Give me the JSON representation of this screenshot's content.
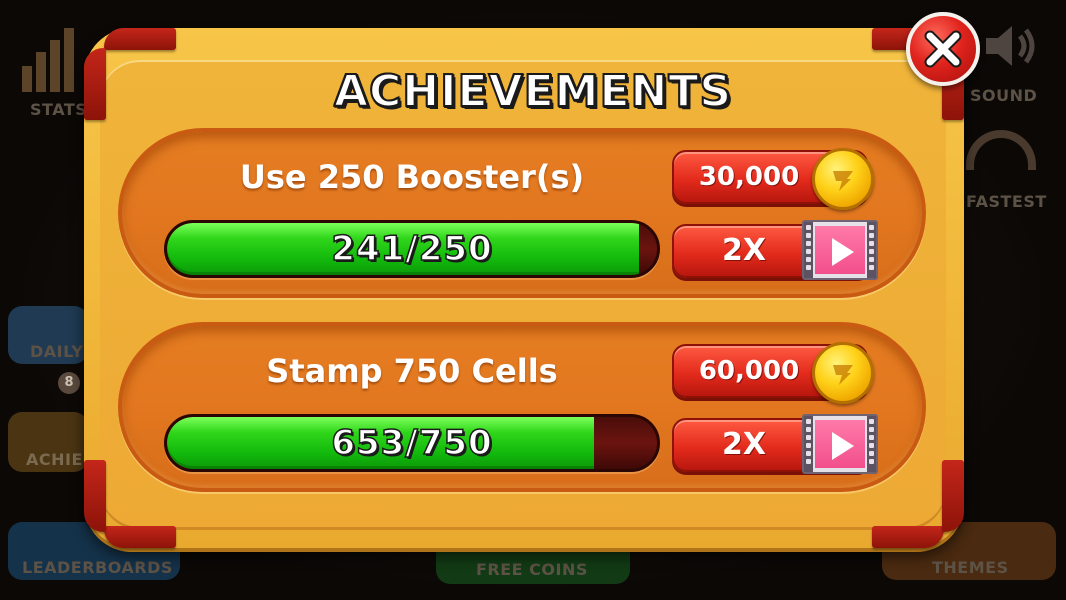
{
  "background_menu": {
    "stats_label": "STATS",
    "sound_label": "SOUND",
    "fastest_label": "FASTEST",
    "daily_label": "DAILY",
    "achievements_label": "ACHIE",
    "achievements_badge": "8",
    "leaderboards_label": "LEADERBOARDS",
    "free_coins_label": "FREE COINS",
    "themes_label": "THEMES"
  },
  "dialog": {
    "title": "ACHIEVEMENTS",
    "close_icon": "close-x-icon"
  },
  "achievements": [
    {
      "title": "Use 250 Booster(s)",
      "progress_text": "241/250",
      "progress_current": 241,
      "progress_total": 250,
      "reward": "30,000",
      "reward_icon": "coin-icon",
      "multiplier_label": "2X",
      "video_icon": "video-play-icon"
    },
    {
      "title": "Stamp 750 Cells",
      "progress_text": "653/750",
      "progress_current": 653,
      "progress_total": 750,
      "reward": "60,000",
      "reward_icon": "coin-icon",
      "multiplier_label": "2X",
      "video_icon": "video-play-icon"
    }
  ],
  "colors": {
    "panel": "#f1b83b",
    "card": "#e2771f",
    "progress_fill": "#12b80c",
    "progress_track": "#6b140f",
    "button": "#e32b1c",
    "close_button": "#e0241d",
    "coin": "#ffd21a"
  }
}
